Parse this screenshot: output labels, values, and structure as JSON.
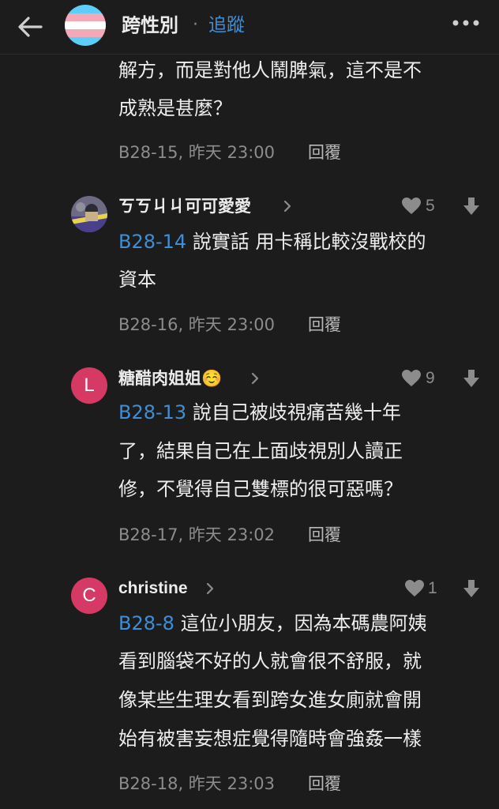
{
  "header": {
    "board_name": "跨性別",
    "separator": "·",
    "follow_label": "追蹤"
  },
  "comments": [
    {
      "lines": [
        "解方，而是對他人鬧脾氣，這不是不",
        "成熟是甚麼？"
      ],
      "floor": "B28-15",
      "time": "昨天 23:00",
      "reply_label": "回覆"
    },
    {
      "username": "ㄎㄎㄐㄐ可可愛愛",
      "likes": "5",
      "reply_to": "B28-14",
      "lines": [
        " 說實話 用卡稱比較沒戰校的",
        "資本"
      ],
      "floor": "B28-16",
      "time": "昨天 23:00",
      "reply_label": "回覆"
    },
    {
      "username": "糖醋肉姐姐",
      "emoji": "☺️",
      "avatar_letter": "L",
      "likes": "9",
      "reply_to": "B28-13",
      "lines": [
        " 說自己被歧視痛苦幾十年",
        "了，結果自己在上面歧視別人讀正",
        "修，不覺得自己雙標的很可惡嗎？"
      ],
      "floor": "B28-17",
      "time": "昨天 23:02",
      "reply_label": "回覆"
    },
    {
      "username": "christine",
      "avatar_letter": "C",
      "likes": "1",
      "reply_to": "B28-8",
      "lines": [
        " 這位小朋友，因為本碼農阿姨",
        "看到腦袋不好的人就會很不舒服，就",
        "像某些生理女看到跨女進女廁就會開",
        "始有被害妄想症覺得隨時會強姦一樣"
      ],
      "floor": "B28-18",
      "time": "昨天 23:03",
      "reply_label": "回覆"
    }
  ],
  "colors": {
    "background": "#1c1c1c",
    "accent": "#3f8ed6",
    "avatar_pink": "#d63a64"
  },
  "icons": {
    "back": "arrow-left-icon",
    "more": "more-dots-icon",
    "like": "heart-icon",
    "dislike": "arrow-down-icon",
    "chevron": "chevron-right-icon"
  }
}
